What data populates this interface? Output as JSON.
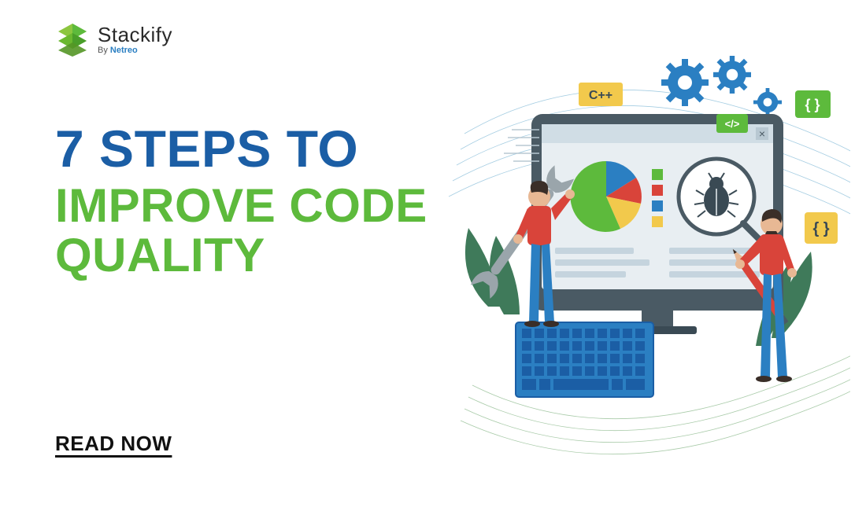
{
  "logo": {
    "brand": "Stackify",
    "byline_prefix": "By ",
    "byline_brand": "Netreo"
  },
  "headline": {
    "line1": "7 STEPS TO",
    "line2": "IMPROVE CODE QUALITY"
  },
  "cta": {
    "label": "READ NOW"
  },
  "illustration": {
    "badge_cpp": "C++",
    "badge_code": "</>",
    "badge_braces_left": "{ }",
    "badge_braces_right": "{ }",
    "close_x": "×"
  },
  "colors": {
    "primary_blue": "#1b5ea5",
    "primary_green": "#5dba3c",
    "accent_red": "#d9443a",
    "accent_yellow": "#f2c94c",
    "accent_teal": "#4aa8a4",
    "gear_blue": "#2b7fc2",
    "dark": "#3a4a54"
  }
}
